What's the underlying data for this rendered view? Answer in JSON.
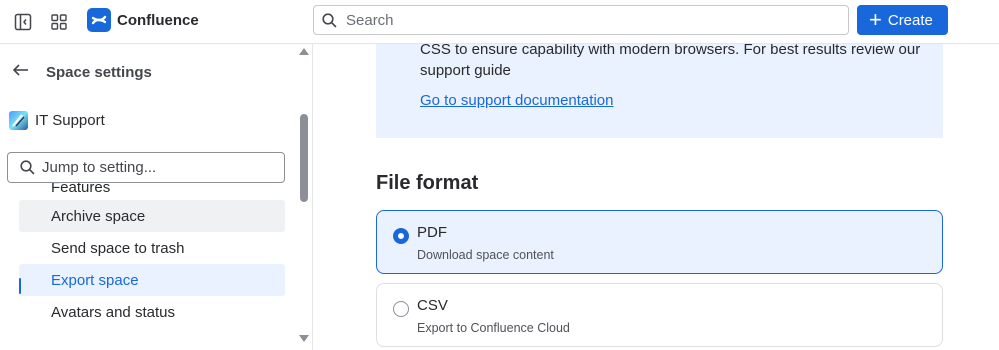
{
  "topbar": {
    "app_name": "Confluence",
    "search_placeholder": "Search",
    "create_label": "Create"
  },
  "sidebar": {
    "back_label": "Space settings",
    "space_name": "IT Support",
    "jump_placeholder": "Jump to setting...",
    "items": [
      {
        "label": "Features",
        "state": "partial"
      },
      {
        "label": "Archive space",
        "state": "hover"
      },
      {
        "label": "Send space to trash",
        "state": "normal"
      },
      {
        "label": "Export space",
        "state": "active"
      },
      {
        "label": "Avatars and status",
        "state": "normal"
      }
    ]
  },
  "main": {
    "info_text": "CSS to ensure capability with modern browsers. For best results review our support guide",
    "info_link": "Go to support documentation",
    "section_title": "File format",
    "options": [
      {
        "title": "PDF",
        "description": "Download space content",
        "selected": true
      },
      {
        "title": "CSV",
        "description": "Export to Confluence Cloud",
        "selected": false
      }
    ]
  },
  "colors": {
    "accent": "#1868db",
    "selected_bg": "#e9f2fe",
    "hover_bg": "#f0f1f2"
  }
}
